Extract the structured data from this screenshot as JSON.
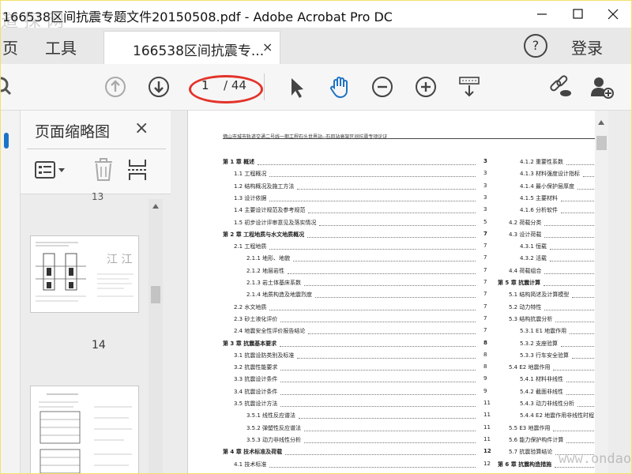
{
  "window": {
    "title": "166538区间抗震专题文件20150508.pdf - Adobe Acrobat Pro DC",
    "watermark_top": "道 探 网",
    "watermark_bottom": "www.ondao.com"
  },
  "tabs": {
    "home": "页",
    "tools": "工具",
    "doc_tab": "166538区间抗震专...",
    "close": "×",
    "help": "?",
    "login": "登录"
  },
  "toolbar": {
    "current_page": "1",
    "total_pages": "/ 44"
  },
  "thumbnails": {
    "title": "页面缩略图",
    "close": "×",
    "top_page_label": "13",
    "page_label_14": "14"
  },
  "document": {
    "header": "佛山市城市轨道交通二号线一期工程石头世界站--石岗站高架区间抗震专项论证",
    "toc_left": [
      {
        "label": "第 1 章  概述",
        "page": "3",
        "level": 0
      },
      {
        "label": "1.1  工程概况",
        "page": "3",
        "level": 1
      },
      {
        "label": "1.2  结构概况及施工方法",
        "page": "3",
        "level": 1
      },
      {
        "label": "1.3  设计依据",
        "page": "3",
        "level": 1
      },
      {
        "label": "1.4  主要设计规范及参考规范",
        "page": "3",
        "level": 1
      },
      {
        "label": "1.5  初步设计评审意见及落实情况",
        "page": "5",
        "level": 1
      },
      {
        "label": "第 2 章  工程地质与水文地质概况",
        "page": "7",
        "level": 0
      },
      {
        "label": "2.1  工程地质",
        "page": "7",
        "level": 1
      },
      {
        "label": "2.1.1  地形、地貌",
        "page": "7",
        "level": 2
      },
      {
        "label": "2.1.2  地层岩性",
        "page": "7",
        "level": 2
      },
      {
        "label": "2.1.3  岩土体基床系数",
        "page": "7",
        "level": 2
      },
      {
        "label": "2.1.4  地质构造及地震烈度",
        "page": "7",
        "level": 2
      },
      {
        "label": "2.2  水文地质",
        "page": "7",
        "level": 1
      },
      {
        "label": "2.3  砂土液化评价",
        "page": "7",
        "level": 1
      },
      {
        "label": "2.4  地震安全性评价报告结论",
        "page": "7",
        "level": 1
      },
      {
        "label": "第 3 章  抗震基本要求",
        "page": "8",
        "level": 0
      },
      {
        "label": "3.1  抗震设防类别及标准",
        "page": "8",
        "level": 1
      },
      {
        "label": "3.2  抗震性能要求",
        "page": "8",
        "level": 1
      },
      {
        "label": "3.3  抗震设计条件",
        "page": "9",
        "level": 1
      },
      {
        "label": "3.4  抗震设计条件",
        "page": "9",
        "level": 1
      },
      {
        "label": "3.5  抗震设计方法",
        "page": "11",
        "level": 1
      },
      {
        "label": "3.5.1  线性反应谱法",
        "page": "11",
        "level": 2
      },
      {
        "label": "3.5.2  弹塑性反应谱法",
        "page": "11",
        "level": 2
      },
      {
        "label": "3.5.3  动力非线性分析",
        "page": "11",
        "level": 2
      },
      {
        "label": "第 4 章  技术标准及荷载",
        "page": "12",
        "level": 0
      },
      {
        "label": "4.1  技术标准",
        "page": "12",
        "level": 1
      }
    ],
    "toc_right": [
      {
        "label": "4.1.2  重要性系数",
        "level": 2
      },
      {
        "label": "4.1.3  材料强度设计指标",
        "level": 2
      },
      {
        "label": "4.1.4  最小保护层厚度",
        "level": 2
      },
      {
        "label": "4.1.5  主要材料",
        "level": 2
      },
      {
        "label": "4.1.6  分析软件",
        "level": 2
      },
      {
        "label": "4.2  荷载分类",
        "level": 1
      },
      {
        "label": "4.3  设计荷载",
        "level": 1
      },
      {
        "label": "4.3.1  恒载",
        "level": 2
      },
      {
        "label": "4.3.2  活载",
        "level": 2
      },
      {
        "label": "4.4  荷载组合",
        "level": 1
      },
      {
        "label": "第 5 章  抗震计算",
        "level": 0
      },
      {
        "label": "5.1  结构简述及计算模型",
        "level": 1
      },
      {
        "label": "5.2  动力特性",
        "level": 1
      },
      {
        "label": "5.3  结构抗震分析",
        "level": 1
      },
      {
        "label": "5.3.1 E1 地震作用",
        "level": 2
      },
      {
        "label": "5.3.2  支座验算",
        "level": 2
      },
      {
        "label": "5.3.3  行车安全验算",
        "level": 2
      },
      {
        "label": "5.4 E2 地震作用",
        "level": 1
      },
      {
        "label": "5.4.1  材料非线性",
        "level": 2
      },
      {
        "label": "5.4.2  截面非线性",
        "level": 2
      },
      {
        "label": "5.4.3  动力非线性分析",
        "level": 2
      },
      {
        "label": "5.4.4 E2 地震作用非线性时程",
        "level": 2
      },
      {
        "label": "5.5 E3 地震作用",
        "level": 1
      },
      {
        "label": "5.6  能力保护构件计算",
        "level": 1
      },
      {
        "label": "5.7  抗震验算结论",
        "level": 1
      },
      {
        "label": "第 6 章  抗震构造措施",
        "level": 0
      }
    ]
  }
}
